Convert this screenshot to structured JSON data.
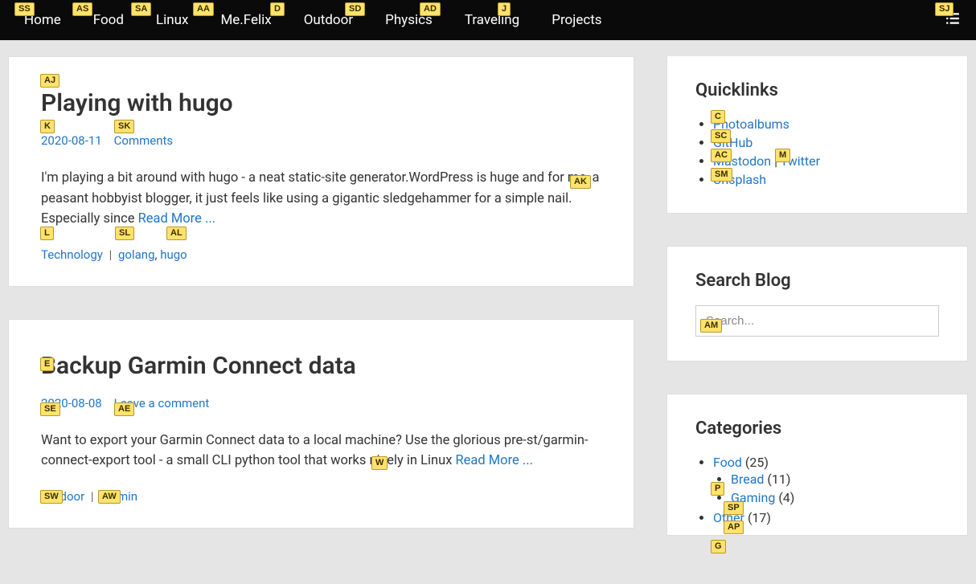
{
  "nav": {
    "items": [
      {
        "label": "Home",
        "hint": "SS"
      },
      {
        "label": "Food",
        "hint": "AS"
      },
      {
        "label": "Linux",
        "hint": "SA"
      },
      {
        "label": "Me.Felix",
        "hint": "AA"
      },
      {
        "label": "Outdoor",
        "hint": "D"
      },
      {
        "label": "Physics",
        "hint": "SD"
      },
      {
        "label": "Traveling",
        "hint": "AD"
      },
      {
        "label": "Projects",
        "hint": "J"
      }
    ],
    "right_hint": "SJ"
  },
  "posts": [
    {
      "title": "Playing with hugo",
      "title_hint": "AJ",
      "date": "2020-08-11",
      "date_hint": "K",
      "comments": "Comments",
      "comments_hint": "SK",
      "excerpt": "I'm playing a bit around with hugo - a neat static-site generator.WordPress is huge and for me, a peasant hobbyist blogger, it just feels like using a gigantic sledgehammer for a simple nail. Especially since ",
      "readmore": "Read More ...",
      "readmore_hint": "AK",
      "cat": {
        "label": "Technology",
        "hint": "L"
      },
      "tags": [
        {
          "label": "golang",
          "hint": "SL"
        },
        {
          "label": "hugo",
          "hint": "AL"
        }
      ]
    },
    {
      "title": "Backup Garmin Connect data",
      "title_hint": "E",
      "date": "2020-08-08",
      "date_hint": "SE",
      "comments": "Leave a comment",
      "comments_hint": "AE",
      "excerpt": "Want to export your Garmin Connect data to a local machine? Use the glorious pre-st/garmin-connect-export tool - a small CLI python tool that works nicely in Linux ",
      "readmore": "Read More ...",
      "readmore_hint": "W",
      "cat": {
        "label": "Outdoor",
        "hint": "SW"
      },
      "tags": [
        {
          "label": "garmin",
          "hint": "AW"
        }
      ]
    }
  ],
  "sidebar": {
    "quicklinks": {
      "title": "Quicklinks",
      "items": [
        {
          "label": "Photoalbums",
          "hint": "C"
        },
        {
          "label": "GitHub",
          "hint": "SC"
        },
        {
          "label": "Mastodon",
          "hint": "AC",
          "sep": " | ",
          "label2": "Twitter",
          "hint2": "M"
        },
        {
          "label": "Unsplash",
          "hint": "SM"
        }
      ]
    },
    "search": {
      "title": "Search Blog",
      "placeholder": "Search...",
      "hint": "AM"
    },
    "categories": {
      "title": "Categories",
      "items": [
        {
          "label": "Food",
          "count": "(25)",
          "hint": "P",
          "children": [
            {
              "label": "Bread",
              "count": "(11)",
              "hint": "SP"
            },
            {
              "label": "Gaming",
              "count": "(4)",
              "hint": "AP"
            }
          ]
        },
        {
          "label": "Other",
          "count": "(17)",
          "hint": "G"
        }
      ]
    }
  }
}
